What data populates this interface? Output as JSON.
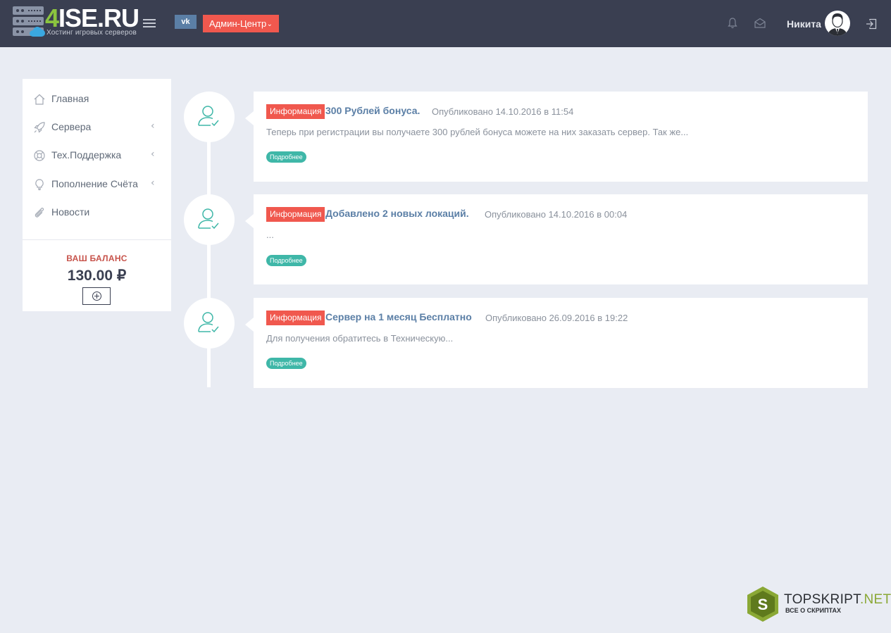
{
  "brand": {
    "logo_prefix": "4",
    "logo_main": "ISE.RU",
    "tagline": "Хостинг игровых серверов"
  },
  "header": {
    "vk_label": "vk",
    "admin_label": "Админ-Центр",
    "user_name": "Никита",
    "icons": [
      "menu-icon",
      "bell-icon",
      "envelope-icon",
      "avatar",
      "logout-icon"
    ]
  },
  "sidebar": {
    "items": [
      {
        "label": "Главная",
        "icon": "home-icon"
      },
      {
        "label": "Сервера",
        "icon": "rocket-icon"
      },
      {
        "label": "Тех.Поддержка",
        "icon": "lifebuoy-icon"
      },
      {
        "label": "Пополнение Счёта",
        "icon": "lightbulb-icon"
      },
      {
        "label": "Новости",
        "icon": "paperclip-icon"
      }
    ],
    "balance_title": "ВАШ БАЛАНС",
    "balance_value": "130.00 ₽"
  },
  "news": [
    {
      "badge": "Информация",
      "title": "300 Рублей бонуса.",
      "date": "Опубликовано 14.10.2016 в 11:54",
      "text": "Теперь при регистрации вы получаете 300 рублей бонуса можете на них заказать сервер. Так же...",
      "more": "Подробнее"
    },
    {
      "badge": "Информация",
      "title": "Добавлено 2 новых локаций.",
      "date": "Опубликовано 14.10.2016 в 00:04",
      "text": "...",
      "more": "Подробнее"
    },
    {
      "badge": "Информация",
      "title": "Сервер на 1 месяц Бесплатно",
      "date": "Опубликовано 26.09.2016 в 19:22",
      "text": "Для получения обратитесь в Техническую...",
      "more": "Подробнее"
    }
  ],
  "watermark": {
    "letter": "S",
    "main_a": "TOPSKRIPT",
    "main_b": ".NET",
    "sub": "ВСЕ О СКРИПТАХ"
  },
  "colors": {
    "topbar": "#3a3f51",
    "accent_red": "#f0584e",
    "link_blue": "#5b7fa6",
    "teal": "#3fb7a8",
    "logo_green": "#8bc53f"
  }
}
